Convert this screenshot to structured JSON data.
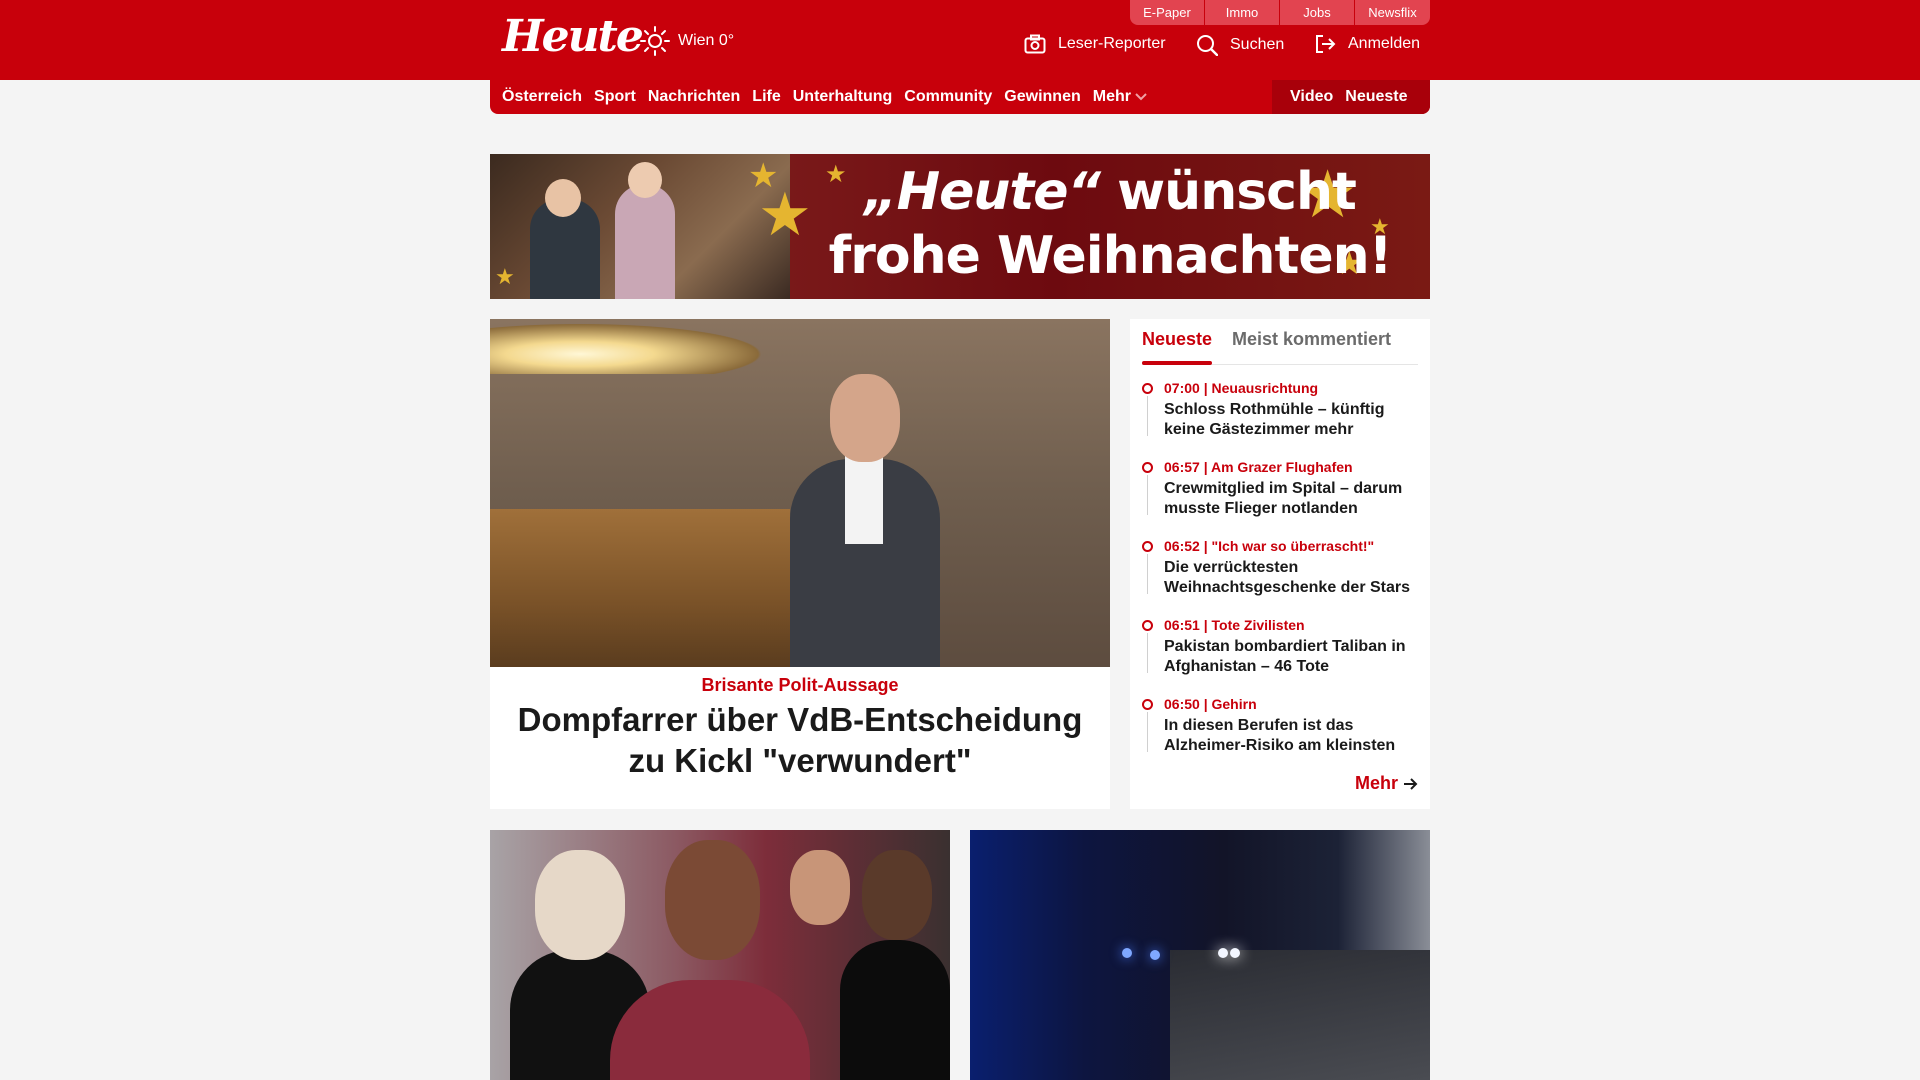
{
  "header": {
    "logo": "Heute",
    "weather": "Wien 0°",
    "top_links": [
      "E-Paper",
      "Immo",
      "Jobs",
      "Newsflix"
    ],
    "actions": {
      "reporter": "Leser-Reporter",
      "search": "Suchen",
      "login": "Anmelden"
    }
  },
  "nav": {
    "items": [
      "Österreich",
      "Sport",
      "Nachrichten",
      "Life",
      "Unterhaltung",
      "Community",
      "Gewinnen"
    ],
    "more": "Mehr",
    "right": [
      "Video",
      "Neueste"
    ]
  },
  "banner": {
    "line1_brand": "„Heute“",
    "line1_rest": " wünscht",
    "line2": "frohe Weihnachten!"
  },
  "lead": {
    "kicker": "Brisante Polit-Aussage",
    "title": "Dompfarrer über VdB-Entscheidung zu Kickl \"verwundert\""
  },
  "latest": {
    "tab_active": "Neueste",
    "tab_inactive": "Meist kommentiert",
    "items": [
      {
        "meta": "07:00 | Neuausrichtung",
        "title": "Schloss Rothmühle – künftig keine Gästezimmer mehr"
      },
      {
        "meta": "06:57 | Am Grazer Flughafen",
        "title": "Crewmitglied im Spital – darum musste Flieger notlanden"
      },
      {
        "meta": "06:52 | \"Ich war so überrascht!\"",
        "title": "Die verrücktesten Weihnachtsgeschenke der Stars"
      },
      {
        "meta": "06:51 | Tote Zivilisten",
        "title": "Pakistan bombardiert Taliban in Afghanistan – 46 Tote"
      },
      {
        "meta": "06:50 | Gehirn",
        "title": "In diesen Berufen ist das Alzheimer-Risiko am kleinsten"
      }
    ],
    "more": "Mehr"
  },
  "colors": {
    "brand_red": "#c8000b",
    "background": "#f4f4f4"
  }
}
